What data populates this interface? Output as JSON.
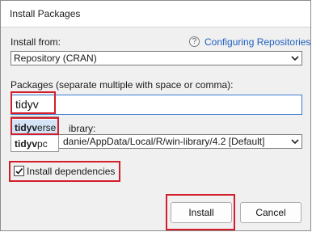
{
  "dialog": {
    "title": "Install Packages",
    "install_from_label": "Install from:",
    "help_link": "Configuring Repositories",
    "install_from_value": "Repository (CRAN)",
    "packages_label": "Packages (separate multiple with space or comma):",
    "packages_value": "tidyv",
    "library_label_partial": "ibrary:",
    "library_value": "danie/AppData/Local/R/win-library/4.2 [Default]",
    "autocomplete": {
      "items": [
        {
          "match": "tidyv",
          "rest": "erse"
        },
        {
          "match": "tidyv",
          "rest": "pc"
        }
      ]
    },
    "install_dependencies_label": "Install dependencies",
    "install_dependencies_checked": true,
    "install_button": "Install",
    "cancel_button": "Cancel"
  },
  "highlight_color": "#d21f2b",
  "icons": [
    "help-icon",
    "chevron-down-icon",
    "check-icon"
  ]
}
